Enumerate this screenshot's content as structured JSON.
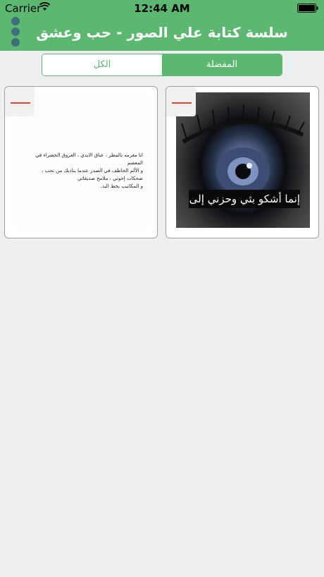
{
  "status_bar": {
    "carrier": "Carrier",
    "time": "12:44 AM"
  },
  "nav": {
    "title": "سلسة كتابة علي الصور - حب وعشق"
  },
  "segments": {
    "all": "الكل",
    "favorites": "المفضلة",
    "selected": "favorites"
  },
  "cards": [
    {
      "quote_lines": [
        "انا مغرمه بالمطر ، عناق الايدي ، العروق الخضراء في المعصم",
        "و الألم الخاطف في الصدر عندما يناديك من تحب ،",
        "ضحكات إخوتي ، ملامح صديقاتي",
        "و المكاتيب بخط اليد."
      ]
    },
    {
      "overlay_text": "إنما أشكو بثي وحزني إلى الله"
    }
  ],
  "colors": {
    "primary": "#5cb870",
    "accent_remove": "#e4442f",
    "menu_dots": "#3f6f79",
    "background": "#eeeff1"
  }
}
